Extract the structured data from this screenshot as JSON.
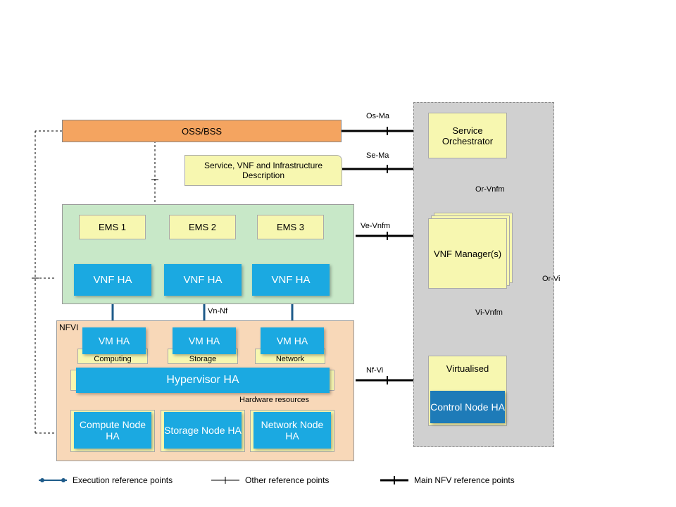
{
  "oss_bss": "OSS/BSS",
  "service_desc": "Service, VNF and Infrastructure Description",
  "ems": {
    "ems1": "EMS 1",
    "ems2": "EMS 2",
    "ems3": "EMS 3"
  },
  "vnf_ha": "VNF HA",
  "vm_ha": "VM HA",
  "hypervisor_ha": "Hypervisor HA",
  "compute_node_ha": "Compute Node HA",
  "storage_node_ha": "Storage Node HA",
  "network_node_ha": "Network Node HA",
  "computing": "Computing",
  "storage": "Storage",
  "network": "Network",
  "hardware_res": "Hardware resources",
  "nfvi": "NFVI",
  "service_orch": "Service Orchestrator",
  "vnf_mgr": "VNF Manager(s)",
  "virtualised": "Virtualised",
  "control_node_ha": "Control Node HA",
  "refs": {
    "os_ma": "Os-Ma",
    "se_ma": "Se-Ma",
    "ve_vnfm": "Ve-Vnfm",
    "vn_nf": "Vn-Nf",
    "nf_vi": "Nf-Vi",
    "or_vnfm": "Or-Vnfm",
    "vi_vnfm": "Vi-Vnfm",
    "or_vi": "Or-Vi"
  },
  "legend": {
    "exec": "Execution reference points",
    "other": "Other reference points",
    "main": "Main NFV reference points"
  },
  "colors": {
    "blue": "#1ba9e1",
    "blue_dark": "#1e7bb8",
    "yellow": "#f7f7b0",
    "oss": "#f4a460",
    "green": "#c8e8c8",
    "peach": "#f8d8b8",
    "grey": "#d0d0d0"
  }
}
